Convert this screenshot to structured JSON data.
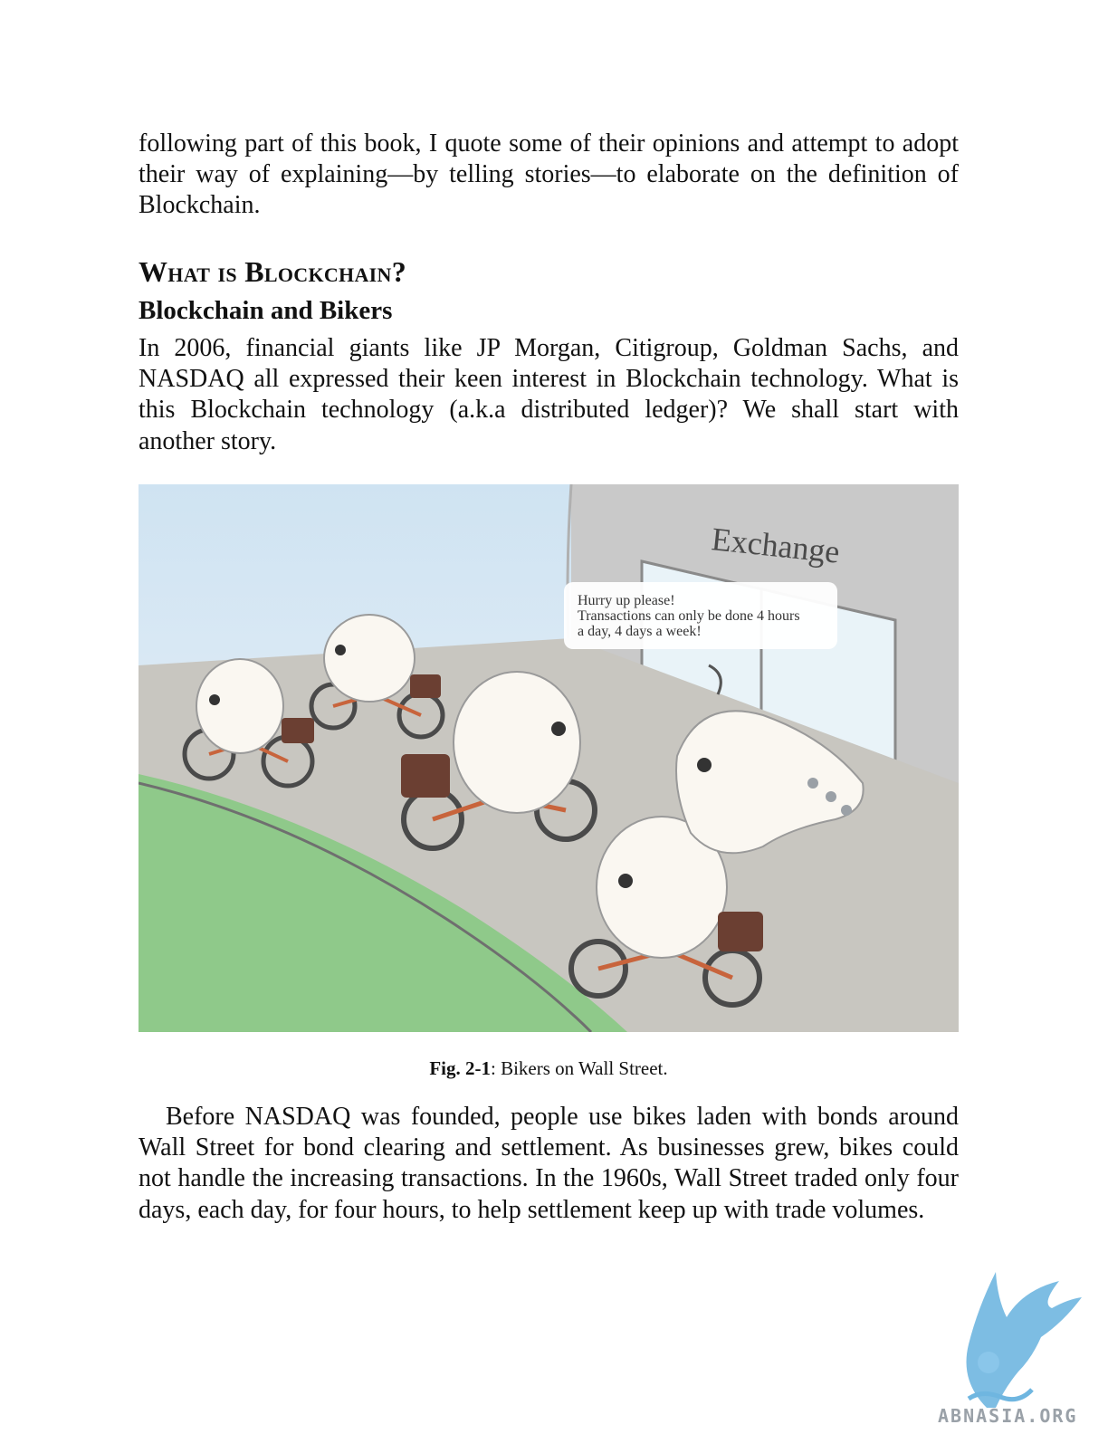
{
  "paragraphs": {
    "intro": "following part of this book, I quote some of their opinions and attempt to adopt their way of explaining—by telling stories—to elaborate on the definition of Blockchain.",
    "p2": "In 2006, financial giants like JP Morgan, Citigroup, Goldman Sachs, and NASDAQ all expressed their keen interest in Blockchain technology. What is this Blockchain technology (a.k.a distributed ledger)? We shall start with another story.",
    "p3": "Before NASDAQ was founded, people use bikes laden with bonds around Wall Street for bond clearing and settlement. As businesses grew, bikes could not handle the increasing transactions. In the 1960s, Wall Street traded only four days, each day, for four hours, to help settlement keep up with trade volumes."
  },
  "headings": {
    "section": "What is Blockchain?",
    "subsection": "Blockchain and Bikers"
  },
  "figure": {
    "sign": "Exchange",
    "bubble_line1": "Hurry up please!",
    "bubble_line2": "Transactions can only be done 4 hours",
    "bubble_line3": "a day, 4 days a week!",
    "caption_label": "Fig. 2-1",
    "caption_text": ": Bikers on Wall Street."
  },
  "watermark": {
    "text": "ABNASIA.ORG",
    "logo_icon": "griffin-logo-icon",
    "color": "#6fb6e0"
  }
}
